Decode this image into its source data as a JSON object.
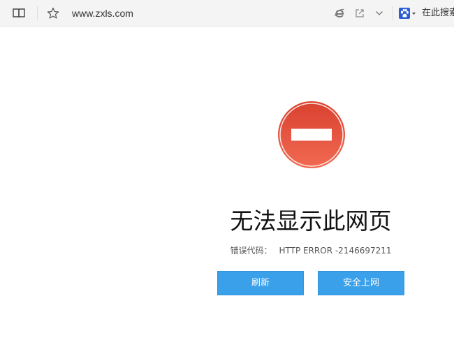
{
  "toolbar": {
    "url": "www.zxls.com",
    "search_label": "在此搜索",
    "icons": {
      "reading_view": "book-icon",
      "favorite": "star-icon",
      "ie_mode": "ie-logo-icon",
      "share": "share-icon",
      "dropdown": "chevron-down-icon",
      "search_engine": "baidu-paw-icon"
    }
  },
  "error": {
    "title": "无法显示此网页",
    "code_label": "错误代码：",
    "code_value": "HTTP ERROR -2146697211",
    "icon": "no-entry-icon"
  },
  "actions": {
    "refresh_label": "刷新",
    "safe_label": "安全上网"
  },
  "colors": {
    "accent_button": "#3aa0e9",
    "error_red": "#e04a38"
  }
}
